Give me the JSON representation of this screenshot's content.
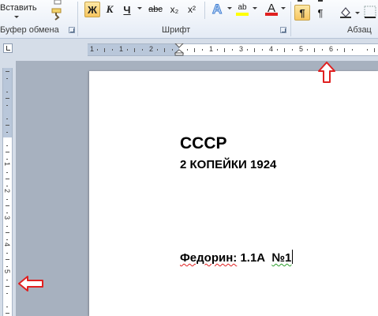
{
  "ribbon": {
    "clipboard": {
      "paste_label": "Вставить",
      "group_label": "Буфер обмена"
    },
    "font": {
      "group_label": "Шрифт",
      "bold_label": "Ж",
      "italic_label": "К",
      "underline_label": "Ч",
      "strike_label": "abc",
      "subscript_label": "x₂",
      "superscript_label": "x²",
      "highlight_label": "ab",
      "font_color_label": "A",
      "highlight_color": "#ffff00",
      "font_color": "#e02020"
    },
    "paragraph": {
      "group_label": "Абзац",
      "pilcrow_label": "¶",
      "rtl_label": "¶",
      "ltr_label": "¶"
    }
  },
  "ruler": {
    "horizontal_numbers": [
      "1",
      "1",
      "2",
      "1",
      "3",
      "4",
      "5",
      "6"
    ],
    "vertical_numbers": [
      "1",
      "2",
      "3",
      "4",
      "5"
    ]
  },
  "document": {
    "line1": "СССР",
    "line2": "2 КОПЕЙКИ 1924",
    "line3_word1": "Федорин:",
    "line3_code": "1.1А",
    "line3_number": "№1"
  },
  "annotations": {
    "arrow_color": "#e02020"
  }
}
